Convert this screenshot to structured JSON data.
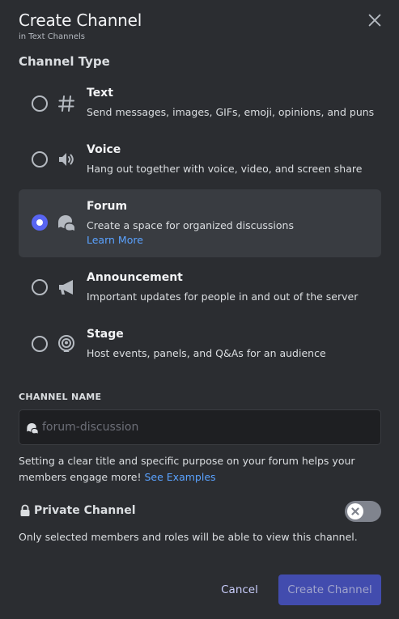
{
  "header": {
    "title": "Create Channel",
    "subtitle": "in Text Channels",
    "close_icon": "close-icon"
  },
  "channel_type": {
    "label": "Channel Type",
    "selected": "forum",
    "options": [
      {
        "id": "text",
        "icon": "hash-icon",
        "title": "Text",
        "description": "Send messages, images, GIFs, emoji, opinions, and puns"
      },
      {
        "id": "voice",
        "icon": "speaker-icon",
        "title": "Voice",
        "description": "Hang out together with voice, video, and screen share"
      },
      {
        "id": "forum",
        "icon": "forum-icon",
        "title": "Forum",
        "description": "Create a space for organized discussions",
        "link": "Learn More"
      },
      {
        "id": "announcement",
        "icon": "megaphone-icon",
        "title": "Announcement",
        "description": "Important updates for people in and out of the server"
      },
      {
        "id": "stage",
        "icon": "stage-icon",
        "title": "Stage",
        "description": "Host events, panels, and Q&As for an audience"
      }
    ]
  },
  "channel_name": {
    "label": "CHANNEL NAME",
    "placeholder": "forum-discussion",
    "value": "",
    "help_text": "Setting a clear title and specific purpose on your forum helps your members engage more!",
    "help_link": "See Examples"
  },
  "private": {
    "label": "Private Channel",
    "enabled": false,
    "description": "Only selected members and roles will be able to view this channel."
  },
  "footer": {
    "cancel_label": "Cancel",
    "create_label": "Create Channel"
  },
  "colors": {
    "background": "#2b2d31",
    "accent": "#5865f2",
    "link": "#5aa2ff",
    "selected_row": "#393c41"
  }
}
